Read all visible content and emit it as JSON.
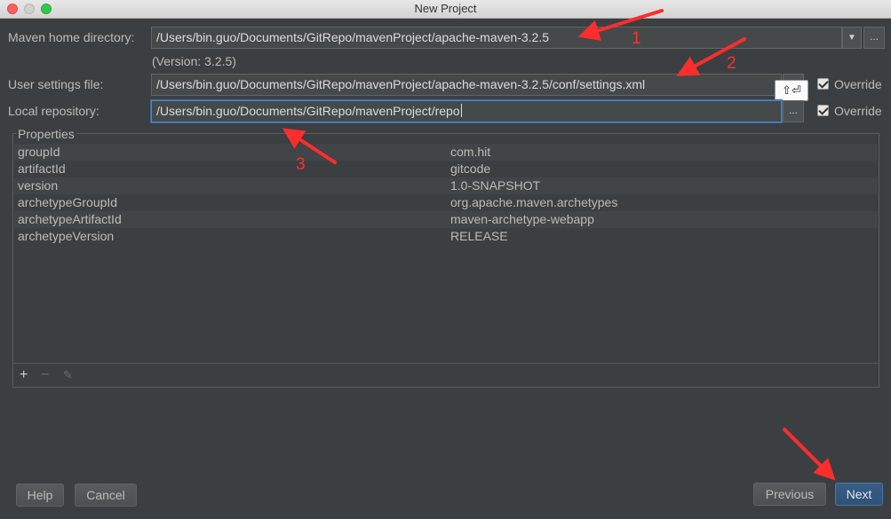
{
  "window": {
    "title": "New Project"
  },
  "maven": {
    "home_label": "Maven home directory:",
    "home_value": "/Users/bin.guo/Documents/GitRepo/mavenProject/apache-maven-3.2.5",
    "version_note": "(Version: 3.2.5)",
    "settings_label": "User settings file:",
    "settings_value": "/Users/bin.guo/Documents/GitRepo/mavenProject/apache-maven-3.2.5/conf/settings.xml",
    "repo_label": "Local repository:",
    "repo_value": "/Users/bin.guo/Documents/GitRepo/mavenProject/repo",
    "override_label": "Override",
    "browse_label": "...",
    "dropdown_glyph": "▼",
    "tooltip_glyph": "⇧⏎"
  },
  "properties": {
    "legend": "Properties",
    "rows": [
      {
        "key": "groupId",
        "value": "com.hit"
      },
      {
        "key": "artifactId",
        "value": "gitcode"
      },
      {
        "key": "version",
        "value": "1.0-SNAPSHOT"
      },
      {
        "key": "archetypeGroupId",
        "value": "org.apache.maven.archetypes"
      },
      {
        "key": "archetypeArtifactId",
        "value": "maven-archetype-webapp"
      },
      {
        "key": "archetypeVersion",
        "value": "RELEASE"
      }
    ],
    "toolbar": {
      "add": "+",
      "remove": "−",
      "edit": "✎"
    }
  },
  "buttons": {
    "help": "Help",
    "cancel": "Cancel",
    "previous": "Previous",
    "next": "Next"
  },
  "annotations": {
    "n1": "1",
    "n2": "2",
    "n3": "3",
    "color": "#ff2d2d"
  }
}
